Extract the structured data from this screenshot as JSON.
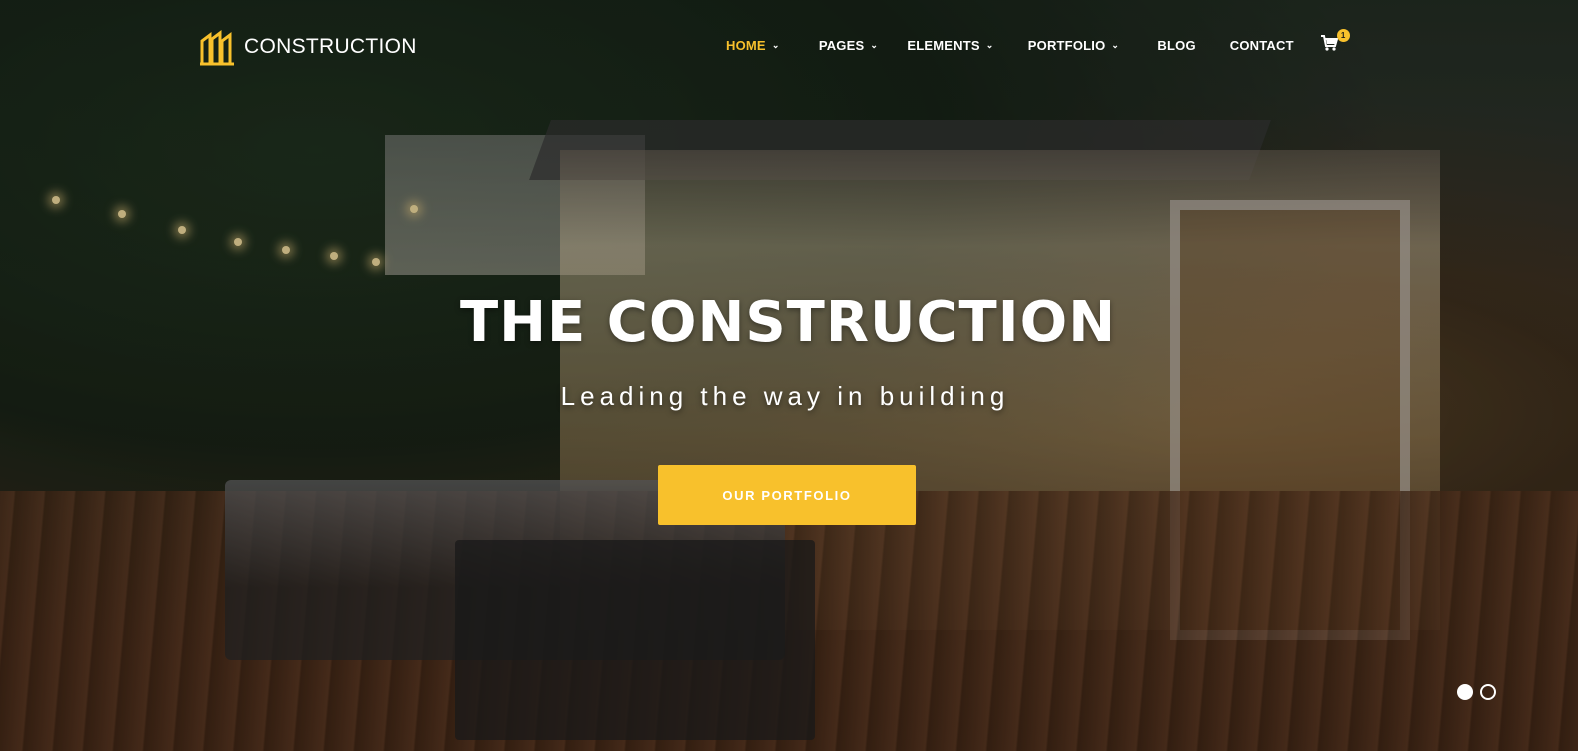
{
  "header": {
    "brand_name": "CONSTRUCTION",
    "logo_icon": "building-icon",
    "logo_color": "#f8c12c"
  },
  "nav": {
    "items": [
      {
        "label": "HOME",
        "active": true,
        "has_dropdown": true
      },
      {
        "label": "PAGES",
        "active": false,
        "has_dropdown": true
      },
      {
        "label": "ELEMENTS",
        "active": false,
        "has_dropdown": true
      },
      {
        "label": "PORTFOLIO",
        "active": false,
        "has_dropdown": true
      },
      {
        "label": "BLOG",
        "active": false,
        "has_dropdown": false
      },
      {
        "label": "CONTACT",
        "active": false,
        "has_dropdown": false
      }
    ],
    "cart_icon": "shopping-cart-icon",
    "cart_count": "1",
    "accent_color": "#f8c12c"
  },
  "hero": {
    "title": "THE CONSTRUCTION",
    "subtitle": "Leading the way in building",
    "button_label": "OUR PORTFOLIO",
    "button_color": "#f8c12c"
  },
  "slider": {
    "total_slides": 2,
    "active_slide": 1
  }
}
